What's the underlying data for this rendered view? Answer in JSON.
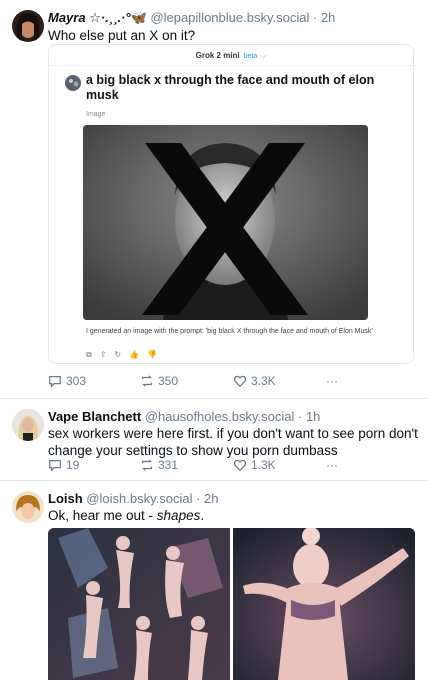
{
  "posts": [
    {
      "author_name": "Mayra ☆·.¸¸.·°",
      "butterfly": "🦋",
      "handle": "@lepapillonblue.bsky.social",
      "time": "· 2h",
      "text": "Who else put an X on it?",
      "replies": "303",
      "reposts": "350",
      "likes": "3.3K",
      "more": "···"
    },
    {
      "author_name": "Vape Blanchett",
      "handle": "@hausofholes.bsky.social",
      "time": "· 1h",
      "text": "sex workers were here first. if you don't want to see porn don't change your settings to show you porn dumbass",
      "replies": "19",
      "reposts": "331",
      "likes": "1.3K",
      "more": "···"
    },
    {
      "author_name": "Loish",
      "handle": "@loish.bsky.social",
      "time": "· 2h",
      "text_prefix": "Ok, hear me out - ",
      "text_italic": "shapes",
      "text_suffix": "."
    }
  ],
  "grok": {
    "model": "Grok 2 mini",
    "beta": "beta",
    "chevron": "⌵",
    "prompt": "a big black x through the face and mouth of elon musk",
    "label": "Image",
    "caption": "I generated an image with the prompt: 'big black X through the face and mouth of Elon Musk'",
    "tools": [
      "⧉",
      "⇧",
      "↻",
      "👍",
      "👎"
    ]
  },
  "icons": {
    "reply": "reply-icon",
    "repost": "repost-icon",
    "like": "heart-icon",
    "more": "more-icon"
  },
  "colors": {
    "handle": "#6b7b8c",
    "accent": "#1d9bf0",
    "divider": "#d9e1e8"
  }
}
